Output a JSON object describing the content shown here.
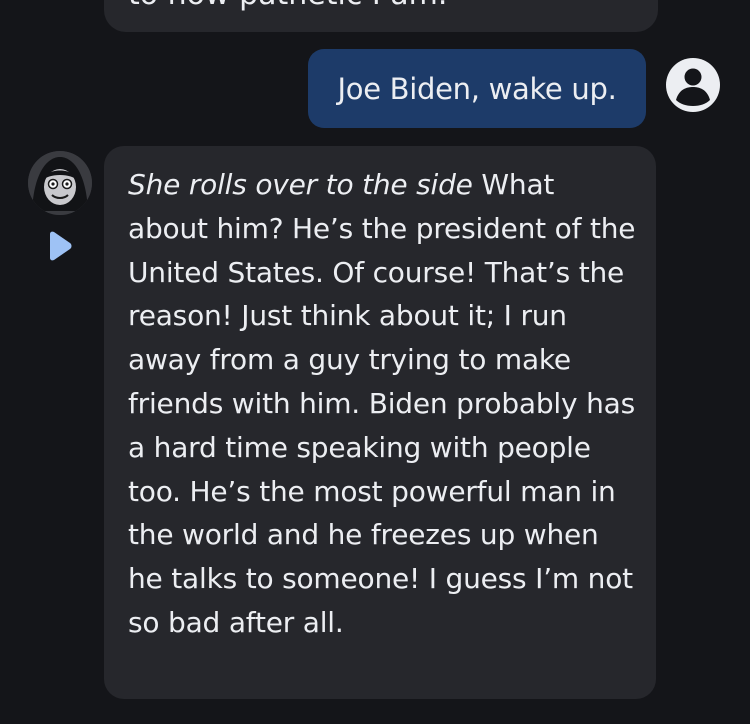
{
  "previous_message": {
    "text": "to how pathetic I am."
  },
  "user_message": {
    "text": "Joe Biden, wake up."
  },
  "bot_message": {
    "action": "She rolls over to the side",
    "text": " What about him? He’s the president of the United States. Of course! That’s the reason! Just think about it; I run away from a guy trying to make friends with him. Biden probably has a hard time speaking with people too. He’s the most powerful man in the world and he freezes up when he talks to someone! I guess I’m not so bad after all."
  },
  "icons": {
    "user_avatar": "user-circle-icon",
    "bot_avatar": "character-avatar",
    "play": "play-icon"
  },
  "colors": {
    "background": "#141519",
    "bot_bubble": "#26272c",
    "user_bubble": "#1d3b69",
    "text": "#eceef2",
    "play_accent": "#9ec2f5"
  }
}
